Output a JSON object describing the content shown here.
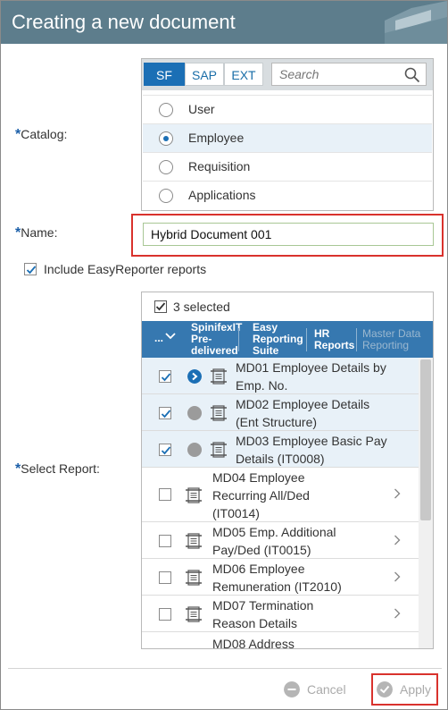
{
  "dialog": {
    "title": "Creating a new document"
  },
  "catalog": {
    "label": "Catalog:",
    "tabs": [
      "SF",
      "SAP",
      "EXT"
    ],
    "active_tab": "SF",
    "search_placeholder": "Search",
    "options": [
      {
        "label": "User",
        "selected": false
      },
      {
        "label": "Employee",
        "selected": true
      },
      {
        "label": "Requisition",
        "selected": false
      },
      {
        "label": "Applications",
        "selected": false
      }
    ]
  },
  "name": {
    "label": "Name:",
    "value": "Hybrid Document 001"
  },
  "include_easyreporter": {
    "label": "Include EasyReporter reports",
    "checked": true
  },
  "report": {
    "label": "Select Report:",
    "selected_count": "3 selected",
    "more_label": "...",
    "tabs": [
      {
        "label": "SpinifexIT Pre-delivered"
      },
      {
        "label": "Easy Reporting Suite"
      },
      {
        "label": "HR Reports"
      },
      {
        "label": "Master Data Reporting"
      }
    ],
    "rows": [
      {
        "line1": "MD01 Employee Details by",
        "line2": "Emp. No.",
        "line3": "",
        "checked": true,
        "status": "active"
      },
      {
        "line1": "MD02 Employee Details",
        "line2": "(Ent Structure)",
        "line3": "",
        "checked": true,
        "status": "grey"
      },
      {
        "line1": "MD03 Employee Basic Pay",
        "line2": "Details (IT0008)",
        "line3": "",
        "checked": true,
        "status": "grey"
      },
      {
        "line1": "MD04 Employee",
        "line2": "Recurring All/Ded",
        "line3": "(IT0014)",
        "checked": false,
        "status": ""
      },
      {
        "line1": "MD05 Emp. Additional",
        "line2": "Pay/Ded (IT0015)",
        "line3": "",
        "checked": false,
        "status": ""
      },
      {
        "line1": "MD06 Employee",
        "line2": "Remuneration (IT2010)",
        "line3": "",
        "checked": false,
        "status": ""
      },
      {
        "line1": "MD07 Termination",
        "line2": "Reason Details",
        "line3": "",
        "checked": false,
        "status": ""
      },
      {
        "line1": "MD08 Address",
        "line2": "",
        "line3": "",
        "checked": false,
        "status": ""
      }
    ]
  },
  "footer": {
    "cancel_label": "Cancel",
    "apply_label": "Apply"
  },
  "colors": {
    "header": "#5d7d8c",
    "accent": "#1b6fb5",
    "highlight": "#d9322d"
  }
}
